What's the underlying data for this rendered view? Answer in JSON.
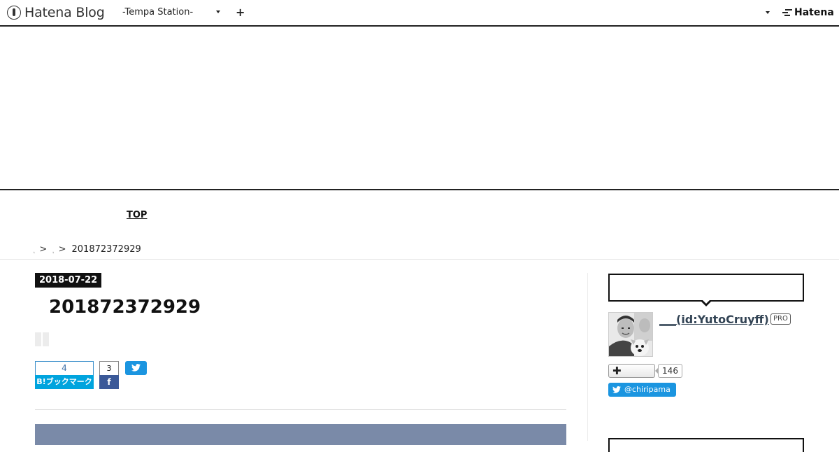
{
  "navbar": {
    "brand": "Hatena Blog",
    "blog_select": "-Tempa Station-",
    "add": "+",
    "hatena_logo": "Hatena"
  },
  "global_nav": {
    "top": "TOP"
  },
  "breadcrumb": {
    "items": [
      "",
      ""
    ],
    "separator": ">",
    "current": "201872372929"
  },
  "entry": {
    "date": "2018-07-22",
    "title": "201872372929",
    "hatena_bookmark": {
      "count": "4",
      "label": "B!ブックマーク"
    },
    "facebook": {
      "count": "3",
      "label": "f"
    }
  },
  "sidebar": {
    "profile": {
      "name": "___(id:YutoCruyff)",
      "badge": "PRO",
      "follower_count": "146",
      "twitter_handle": "@chiripama"
    }
  },
  "colors": {
    "hatena_bookmark": "#00a4de",
    "facebook": "#3b5998",
    "twitter": "#1b95e0",
    "entry_image": "#7a8aa8"
  },
  "icons": [
    "hatena-blog-logo-icon",
    "caret-down-icon",
    "plus-icon",
    "hatena-logo-icon",
    "twitter-bird-icon",
    "facebook-icon"
  ]
}
